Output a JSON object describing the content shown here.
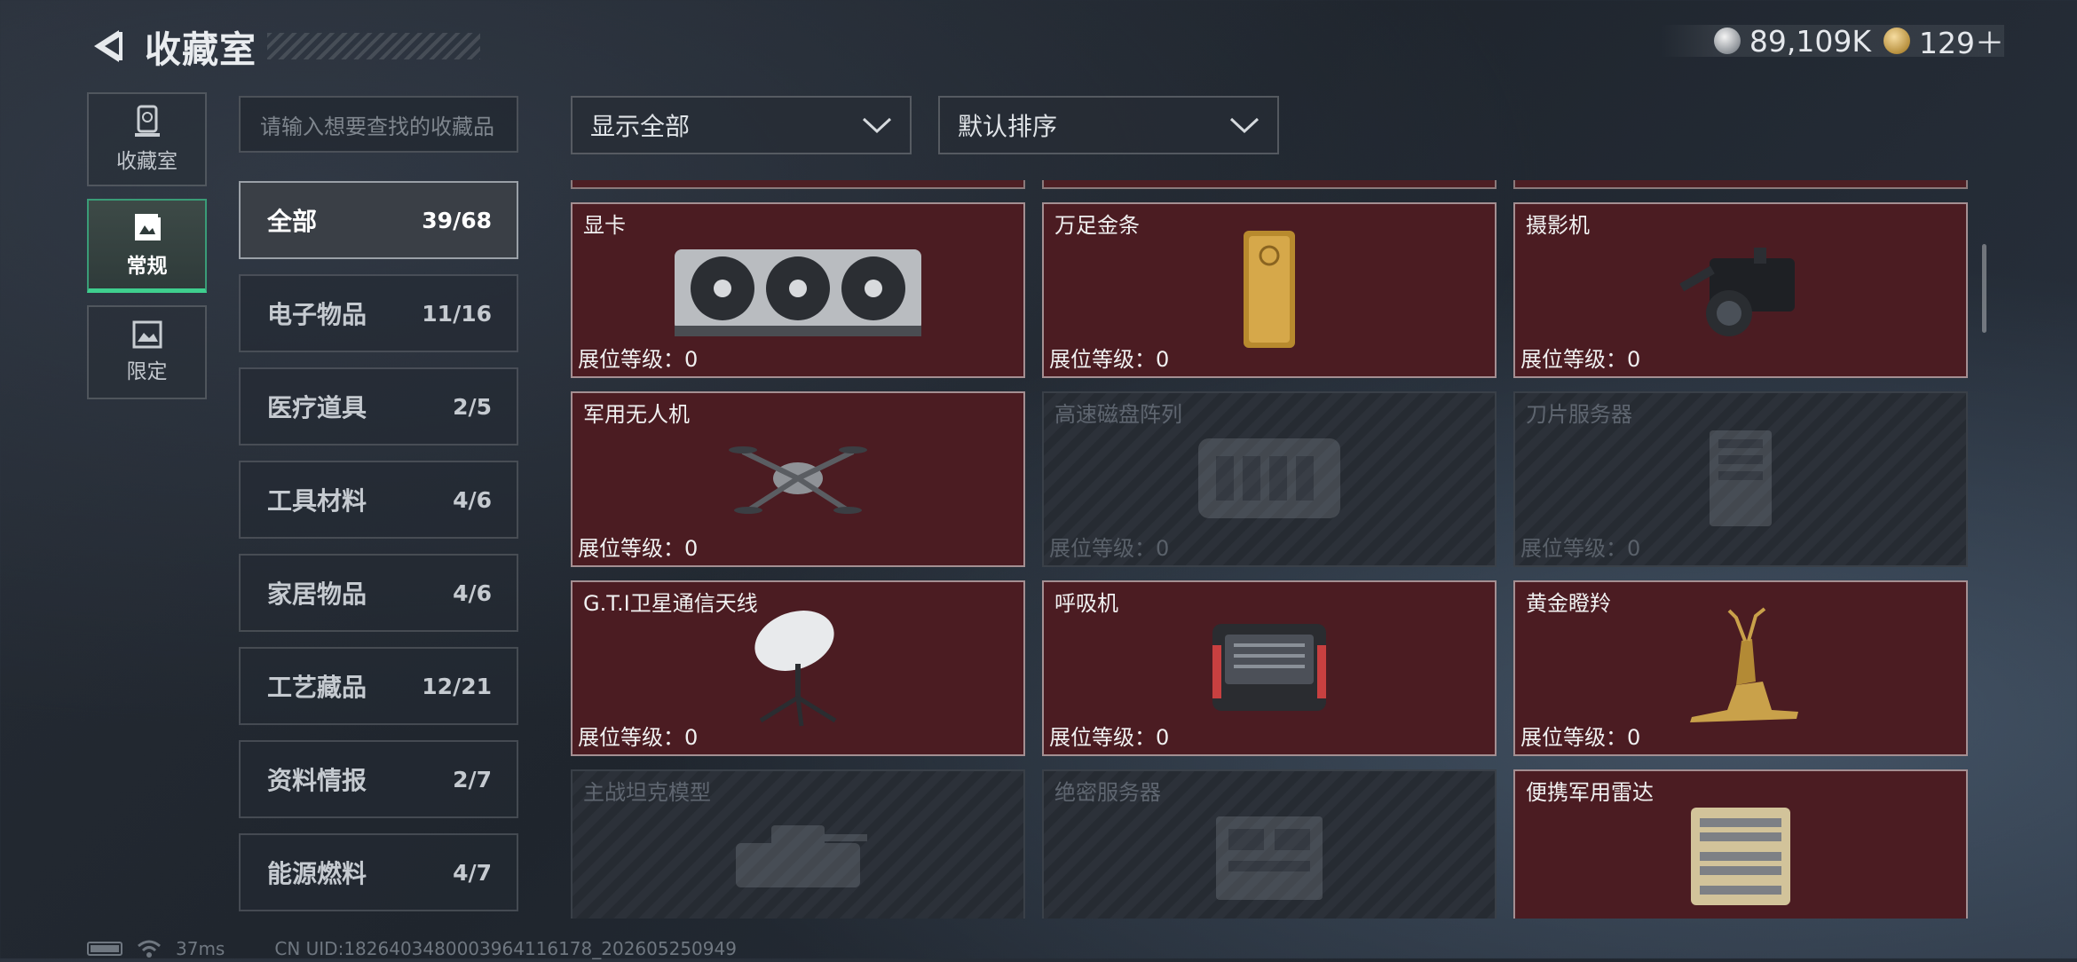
{
  "header": {
    "title": "收藏室",
    "currency": [
      {
        "icon": "silver-coin-icon",
        "value": "89,109K"
      },
      {
        "icon": "gold-coin-icon",
        "value": "129＋"
      }
    ]
  },
  "side_tabs": [
    {
      "label": "收藏室",
      "icon": "trophy-icon",
      "active": false
    },
    {
      "label": "常规",
      "icon": "album-icon",
      "active": true
    },
    {
      "label": "限定",
      "icon": "image-icon",
      "active": false
    }
  ],
  "search": {
    "placeholder": "请输入想要查找的收藏品"
  },
  "categories": [
    {
      "name": "全部",
      "count": "39/68",
      "active": true
    },
    {
      "name": "电子物品",
      "count": "11/16"
    },
    {
      "name": "医疗道具",
      "count": "2/5"
    },
    {
      "name": "工具材料",
      "count": "4/6"
    },
    {
      "name": "家居物品",
      "count": "4/6"
    },
    {
      "name": "工艺藏品",
      "count": "12/21"
    },
    {
      "name": "资料情报",
      "count": "2/7"
    },
    {
      "name": "能源燃料",
      "count": "4/7"
    }
  ],
  "filters": {
    "display": "显示全部",
    "sort": "默认排序"
  },
  "items": [
    {
      "name": "显卡",
      "level": "展位等级：0",
      "unlocked": true,
      "icon": "graphics-card-icon"
    },
    {
      "name": "万足金条",
      "level": "展位等级：0",
      "unlocked": true,
      "icon": "gold-bar-icon"
    },
    {
      "name": "摄影机",
      "level": "展位等级：0",
      "unlocked": true,
      "icon": "video-camera-icon"
    },
    {
      "name": "军用无人机",
      "level": "展位等级：0",
      "unlocked": true,
      "icon": "drone-icon"
    },
    {
      "name": "高速磁盘阵列",
      "level": "展位等级：0",
      "unlocked": false,
      "icon": "disk-array-icon"
    },
    {
      "name": "刀片服务器",
      "level": "展位等级：0",
      "unlocked": false,
      "icon": "blade-server-icon"
    },
    {
      "name": "G.T.I卫星通信天线",
      "level": "展位等级：0",
      "unlocked": true,
      "icon": "satellite-dish-icon"
    },
    {
      "name": "呼吸机",
      "level": "展位等级：0",
      "unlocked": true,
      "icon": "ventilator-icon"
    },
    {
      "name": "黄金瞪羚",
      "level": "展位等级：0",
      "unlocked": true,
      "icon": "golden-gazelle-icon"
    },
    {
      "name": "主战坦克模型",
      "level": "",
      "unlocked": false,
      "icon": "tank-model-icon"
    },
    {
      "name": "绝密服务器",
      "level": "",
      "unlocked": false,
      "icon": "server-icon"
    },
    {
      "name": "便携军用雷达",
      "level": "",
      "unlocked": true,
      "icon": "radar-icon"
    }
  ],
  "footer": {
    "ping": "37ms",
    "uid": "CN UID:1826403480003964116178_202605250949"
  },
  "colors": {
    "unlocked_card": "#4b1c22",
    "active_accent": "#3fcf8e"
  }
}
